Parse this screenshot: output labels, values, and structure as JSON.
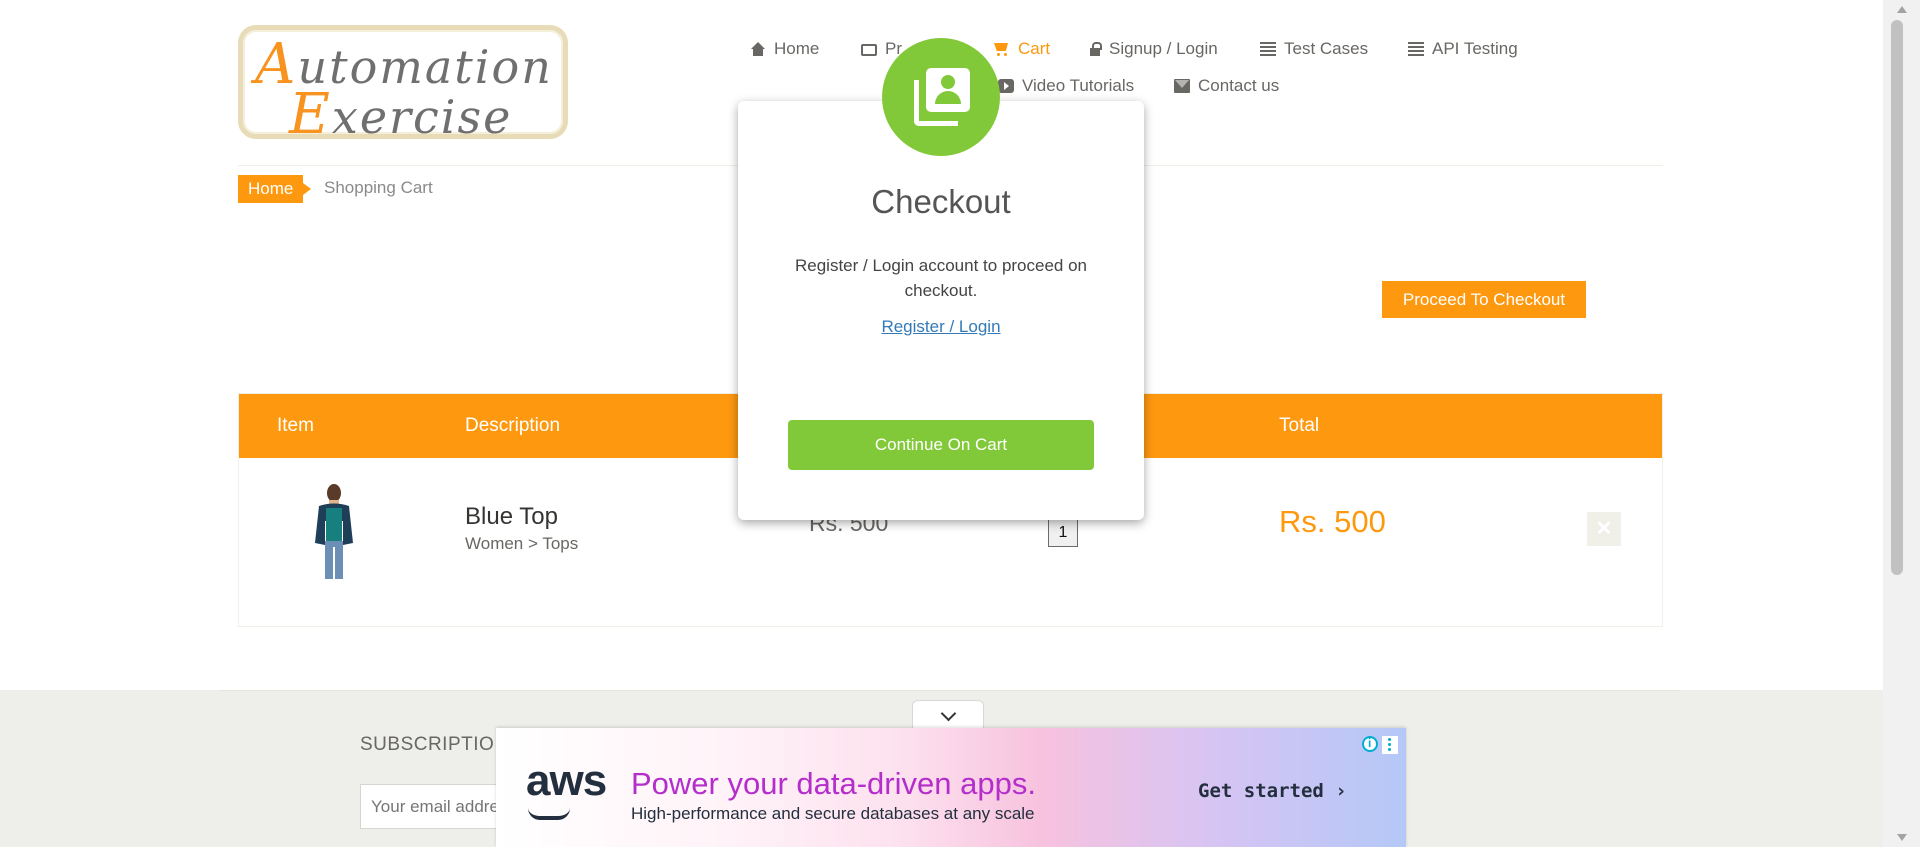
{
  "logo": {
    "line1_cap": "A",
    "line1_rest": "utomation",
    "line2_cap": "E",
    "line2_rest": "xercise"
  },
  "nav": {
    "items": [
      {
        "label": "Home",
        "icon": "home-icon"
      },
      {
        "label": "Pr",
        "icon": "briefcase-icon"
      },
      {
        "label": "Cart",
        "icon": "cart-icon",
        "active": true
      },
      {
        "label": "Signup / Login",
        "icon": "lock-icon"
      },
      {
        "label": "Test Cases",
        "icon": "list-icon"
      },
      {
        "label": "API Testing",
        "icon": "list-icon"
      },
      {
        "label": "Video Tutorials",
        "icon": "youtube-icon"
      },
      {
        "label": "Contact us",
        "icon": "envelope-icon"
      }
    ]
  },
  "breadcrumb": {
    "home": "Home",
    "current": "Shopping Cart"
  },
  "proceed_button": "Proceed To Checkout",
  "cart": {
    "headers": {
      "item": "Item",
      "description": "Description",
      "total": "Total"
    },
    "rows": [
      {
        "name": "Blue Top",
        "category": "Women > Tops",
        "price": "Rs. 500",
        "quantity": "1",
        "total": "Rs. 500"
      }
    ]
  },
  "footer": {
    "subscription_title": "SUBSCRIPTIO",
    "email_placeholder": "Your email addre"
  },
  "ad": {
    "logo": "aws",
    "headline": "Power your data-driven apps.",
    "subline": "High-performance and secure databases at any scale",
    "cta": "Get started ›"
  },
  "modal": {
    "title": "Checkout",
    "text": "Register / Login account to proceed on checkout.",
    "link": "Register / Login",
    "button": "Continue On Cart"
  },
  "colors": {
    "accent": "#fe980f",
    "modal_green": "#82c93a",
    "link": "#337ab7"
  }
}
